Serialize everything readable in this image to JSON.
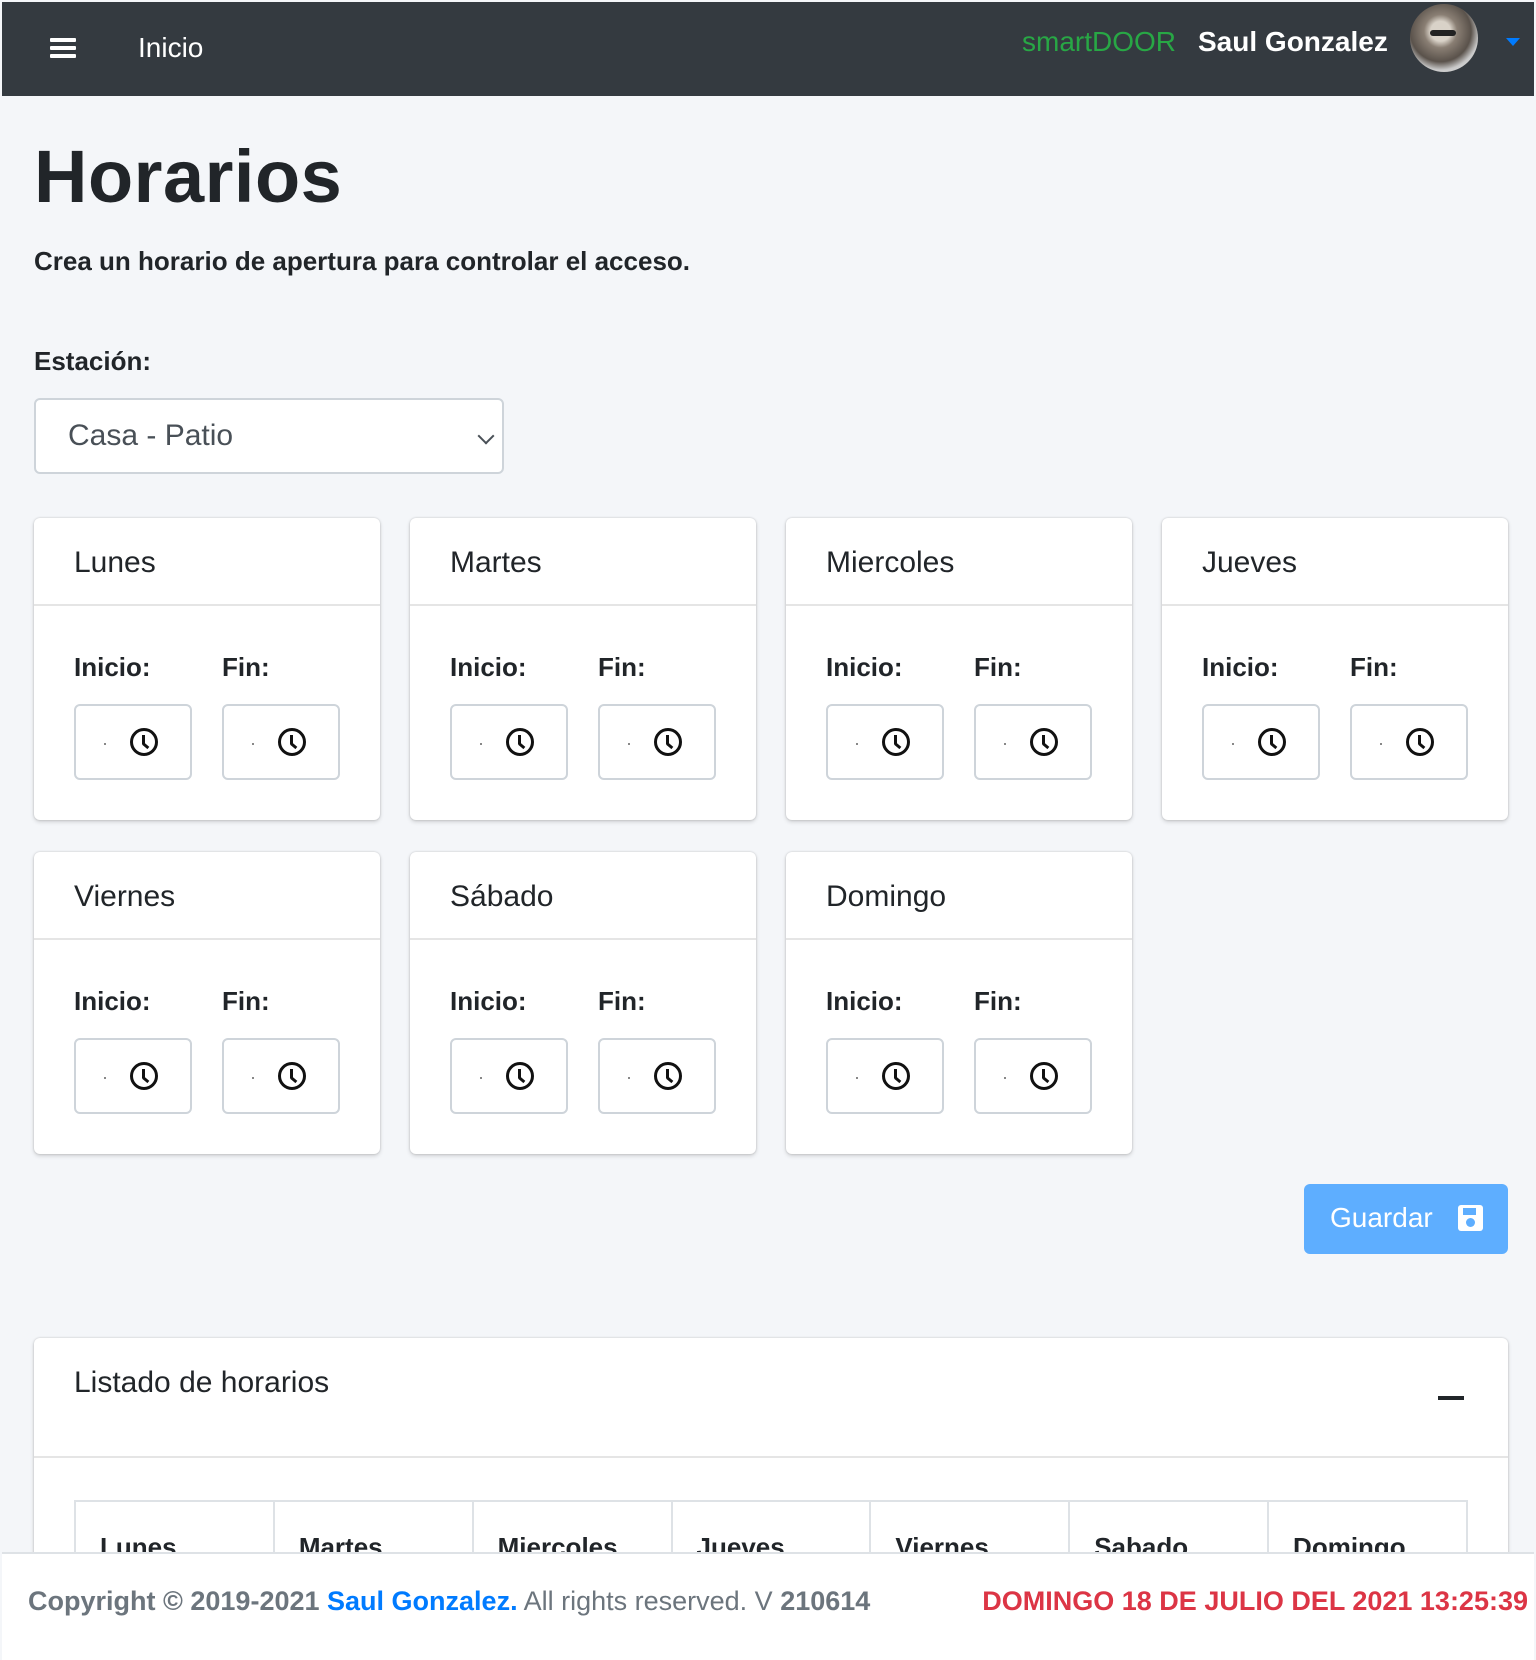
{
  "navbar": {
    "home_label": "Inicio",
    "brand": "smartDOOR",
    "username": "Saul Gonzalez"
  },
  "page": {
    "title": "Horarios",
    "subtitle": "Crea un horario de apertura para controlar el acceso."
  },
  "station": {
    "label": "Estación:",
    "selected": "Casa - Patio"
  },
  "days": [
    {
      "name": "Lunes",
      "start_label": "Inicio:",
      "end_label": "Fin:"
    },
    {
      "name": "Martes",
      "start_label": "Inicio:",
      "end_label": "Fin:"
    },
    {
      "name": "Miercoles",
      "start_label": "Inicio:",
      "end_label": "Fin:"
    },
    {
      "name": "Jueves",
      "start_label": "Inicio:",
      "end_label": "Fin:"
    },
    {
      "name": "Viernes",
      "start_label": "Inicio:",
      "end_label": "Fin:"
    },
    {
      "name": "Sábado",
      "start_label": "Inicio:",
      "end_label": "Fin:"
    },
    {
      "name": "Domingo",
      "start_label": "Inicio:",
      "end_label": "Fin:"
    }
  ],
  "save_button": {
    "label": "Guardar",
    "icon": "save-icon"
  },
  "schedule_list": {
    "title": "Listado de horarios",
    "columns": [
      "Lunes",
      "Martes",
      "Miercoles",
      "Jueves",
      "Viernes",
      "Sabado",
      "Domingo"
    ]
  },
  "footer": {
    "copyright_prefix": "Copyright © 2019-2021",
    "author": "Saul Gonzalez.",
    "rights": "All rights reserved. V",
    "version": "210614",
    "datetime": "DOMINGO 18 DE JULIO DEL 2021 13:25:39"
  },
  "colors": {
    "navbar_bg": "#343a40",
    "brand": "#28a745",
    "accent": "#007bff",
    "save_button": "#5eaeff",
    "datetime": "#dc3545"
  }
}
